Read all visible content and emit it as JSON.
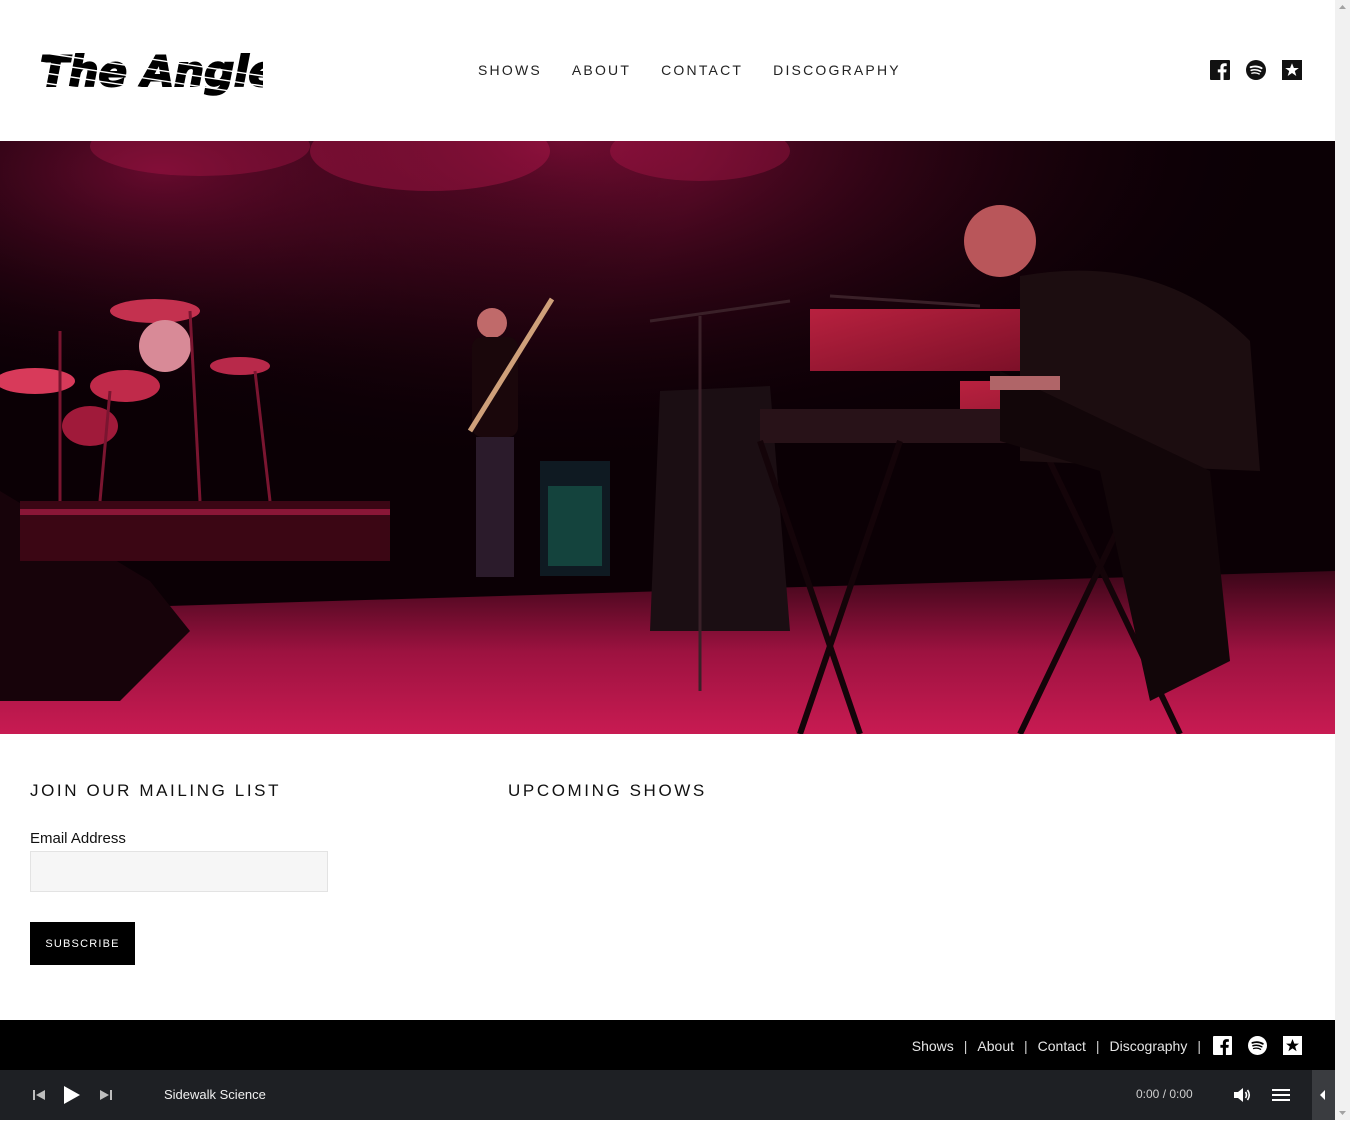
{
  "brand": {
    "logo_text": "The Angle"
  },
  "nav": {
    "items": [
      {
        "label": "SHOWS"
      },
      {
        "label": "ABOUT"
      },
      {
        "label": "CONTACT"
      },
      {
        "label": "DISCOGRAPHY"
      }
    ]
  },
  "social_icons": [
    "facebook-icon",
    "spotify-icon",
    "reverbnation-star-icon"
  ],
  "mailing": {
    "title": "JOIN OUR MAILING LIST",
    "email_label": "Email Address",
    "email_value": "",
    "button_label": "SUBSCRIBE"
  },
  "shows": {
    "title": "UPCOMING SHOWS"
  },
  "footer": {
    "links": [
      {
        "label": "Shows"
      },
      {
        "label": "About"
      },
      {
        "label": "Contact"
      },
      {
        "label": "Discography"
      }
    ],
    "separator": "|"
  },
  "player": {
    "track_title": "Sidewalk Science",
    "time": "0:00 / 0:00",
    "progress": 0
  },
  "colors": {
    "header_bg": "#ffffff",
    "footer_bg": "#000000",
    "player_bg": "#1e2024",
    "button_bg": "#000000",
    "hero_tint": "#c0124a"
  }
}
